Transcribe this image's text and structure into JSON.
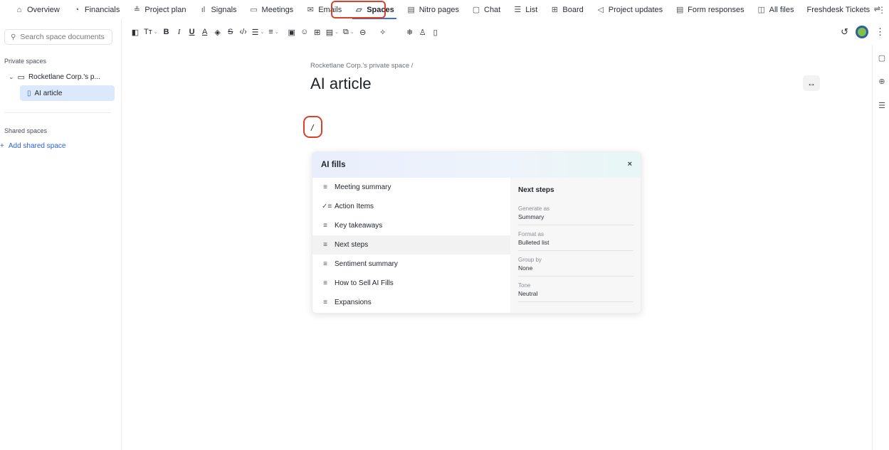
{
  "nav": {
    "items": [
      {
        "label": "Overview",
        "icon": "home-icon"
      },
      {
        "label": "Financials",
        "icon": "money-icon"
      },
      {
        "label": "Project plan",
        "icon": "plan-icon"
      },
      {
        "label": "Signals",
        "icon": "signal-icon"
      },
      {
        "label": "Meetings",
        "icon": "calendar-icon"
      },
      {
        "label": "Emails",
        "icon": "mail-icon"
      },
      {
        "label": "Spaces",
        "icon": "folder-icon",
        "active": true
      },
      {
        "label": "Nitro pages",
        "icon": "page-icon"
      },
      {
        "label": "Chat",
        "icon": "chat-icon"
      },
      {
        "label": "List",
        "icon": "list-icon"
      },
      {
        "label": "Board",
        "icon": "board-icon"
      },
      {
        "label": "Project updates",
        "icon": "megaphone-icon"
      },
      {
        "label": "Form responses",
        "icon": "form-icon"
      },
      {
        "label": "All files",
        "icon": "files-icon"
      },
      {
        "label": "Freshdesk Tickets",
        "icon": ""
      }
    ],
    "more": "⋮",
    "right_icon": "filter-icon"
  },
  "sidebar": {
    "search_placeholder": "Search space documents",
    "private_heading": "Private spaces",
    "private_space": "Rocketlane Corp.'s p...",
    "selected_doc": "AI article",
    "shared_heading": "Shared spaces",
    "add_shared": "Add shared space"
  },
  "document": {
    "breadcrumb": "Rocketlane Corp.'s private space /",
    "title": "AI article",
    "typed": "/"
  },
  "ai_fills": {
    "title": "AI fills",
    "close": "×",
    "items": [
      {
        "label": "Meeting summary",
        "icon": "lines-icon"
      },
      {
        "label": "Action Items",
        "icon": "checklist-icon"
      },
      {
        "label": "Key takeaways",
        "icon": "lines-icon"
      },
      {
        "label": "Next steps",
        "icon": "lines-icon",
        "active": true
      },
      {
        "label": "Sentiment summary",
        "icon": "lines-icon"
      },
      {
        "label": "How to Sell AI Fills",
        "icon": "lines-icon"
      },
      {
        "label": "Expansions",
        "icon": "lines-icon"
      }
    ],
    "detail": {
      "title": "Next steps",
      "fields": [
        {
          "label": "Generate as",
          "value": "Summary"
        },
        {
          "label": "Format as",
          "value": "Bulleted list"
        },
        {
          "label": "Group by",
          "value": "None"
        },
        {
          "label": "Tone",
          "value": "Neutral"
        }
      ]
    }
  },
  "colors": {
    "accent": "#3b6fe0",
    "highlight": "#d9412b",
    "selected_bg": "#dce8fb",
    "link": "#2a62d8"
  }
}
